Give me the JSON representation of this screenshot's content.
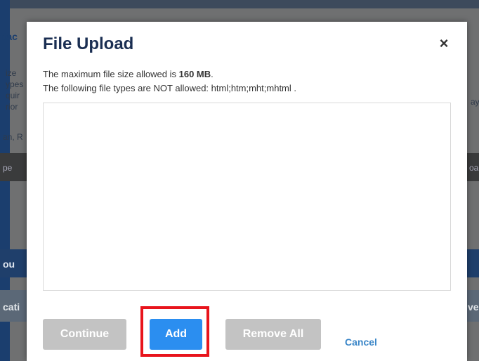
{
  "background": {
    "fragments": [
      "ttac",
      "ize",
      "ypes",
      "quir",
      "rior",
      "an, R",
      "pe",
      "oa",
      "ay",
      "ou",
      "cati",
      "ve"
    ]
  },
  "dialog": {
    "title": "File Upload",
    "close_symbol": "×",
    "max_size_prefix": "The maximum file size allowed is ",
    "max_size_value": "160 MB",
    "max_size_suffix": ".",
    "disallowed_types": "The following file types are NOT allowed: html;htm;mht;mhtml ."
  },
  "buttons": {
    "continue": "Continue",
    "add": "Add",
    "remove_all": "Remove All",
    "cancel": "Cancel"
  },
  "colors": {
    "title": "#1a2e52",
    "add_button": "#2b8ef0",
    "disabled_button": "#c3c3c3",
    "cancel_link": "#3a86c8",
    "highlight_border": "#e8141c"
  }
}
